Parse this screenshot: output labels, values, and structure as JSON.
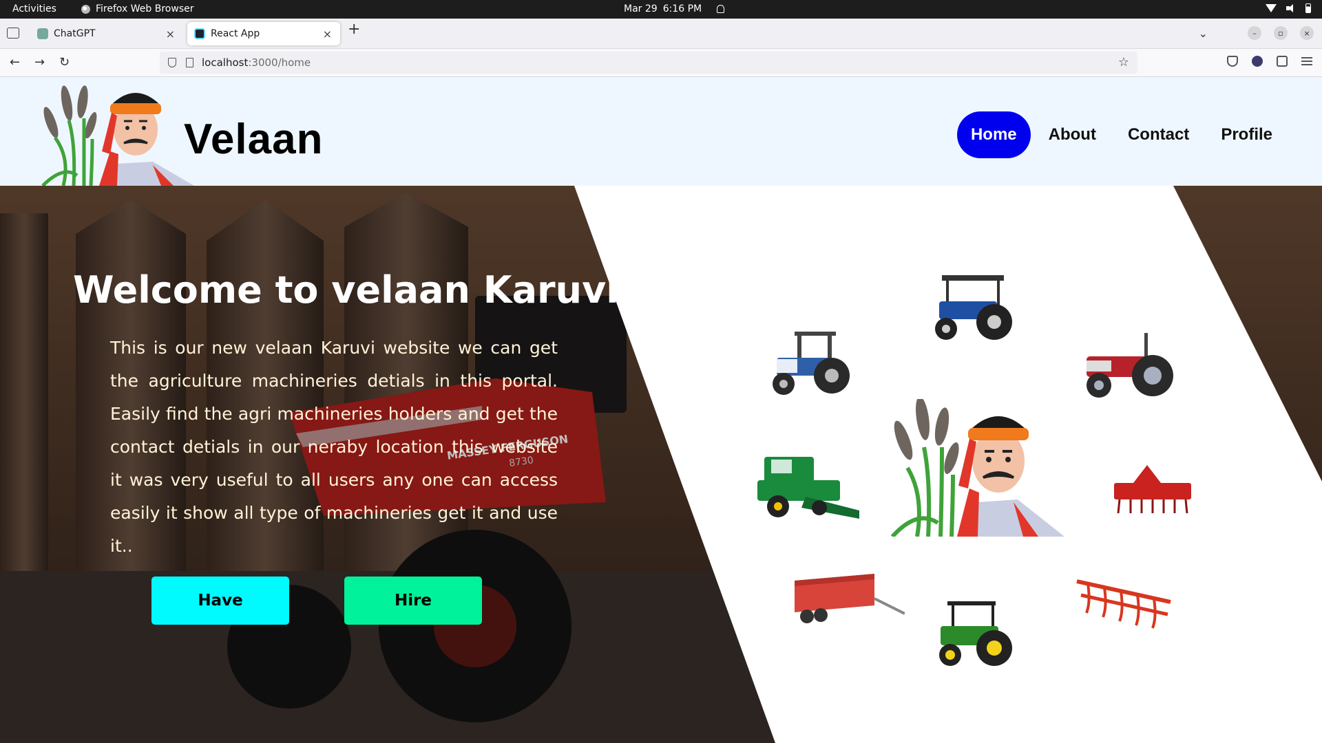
{
  "os_bar": {
    "activities": "Activities",
    "app_name": "Firefox Web Browser",
    "date": "Mar 29",
    "time": "6:16 PM"
  },
  "browser": {
    "tabs": [
      {
        "title": "ChatGPT",
        "close": "×"
      },
      {
        "title": "React App",
        "close": "×"
      }
    ],
    "new_tab": "+",
    "url_host": "localhost",
    "url_path": ":3000/home",
    "back": "←",
    "forward": "→",
    "reload": "↻",
    "bookmark": "☆",
    "tab_overflow": "⌄",
    "win_min": "–",
    "win_max": "▫",
    "win_close": "×"
  },
  "site": {
    "brand": "Velaan",
    "nav": [
      {
        "label": "Home",
        "active": true
      },
      {
        "label": "About",
        "active": false
      },
      {
        "label": "Contact",
        "active": false
      },
      {
        "label": "Profile",
        "active": false
      }
    ],
    "hero": {
      "title": "Welcome to velaan Karuvigal",
      "description": "This is our new velaan Karuvi website we can get the agriculture machineries detials in this portal. Easily find the agri machineries holders and get the contact detials in our neraby location this website it was very useful to all users any one can access easily it show all type of machineries get it and use it..",
      "background_text": "MASSEY FERGUSON",
      "background_model": "8730",
      "buttons": {
        "have": "Have",
        "hire": "Hire"
      }
    },
    "colors": {
      "nav_active": "#0000ee",
      "have_button": "#00fbff",
      "hire_button": "#00f29a",
      "header_bg": "#eef7ff"
    },
    "gallery_icons": [
      "blue-tractor-icon",
      "swaraj-tractor-icon",
      "red-tractor-icon",
      "combine-harvester-icon",
      "farmer-mascot-icon",
      "rotavator-icon",
      "trailer-icon",
      "green-tractor-icon",
      "cultivator-icon"
    ]
  }
}
